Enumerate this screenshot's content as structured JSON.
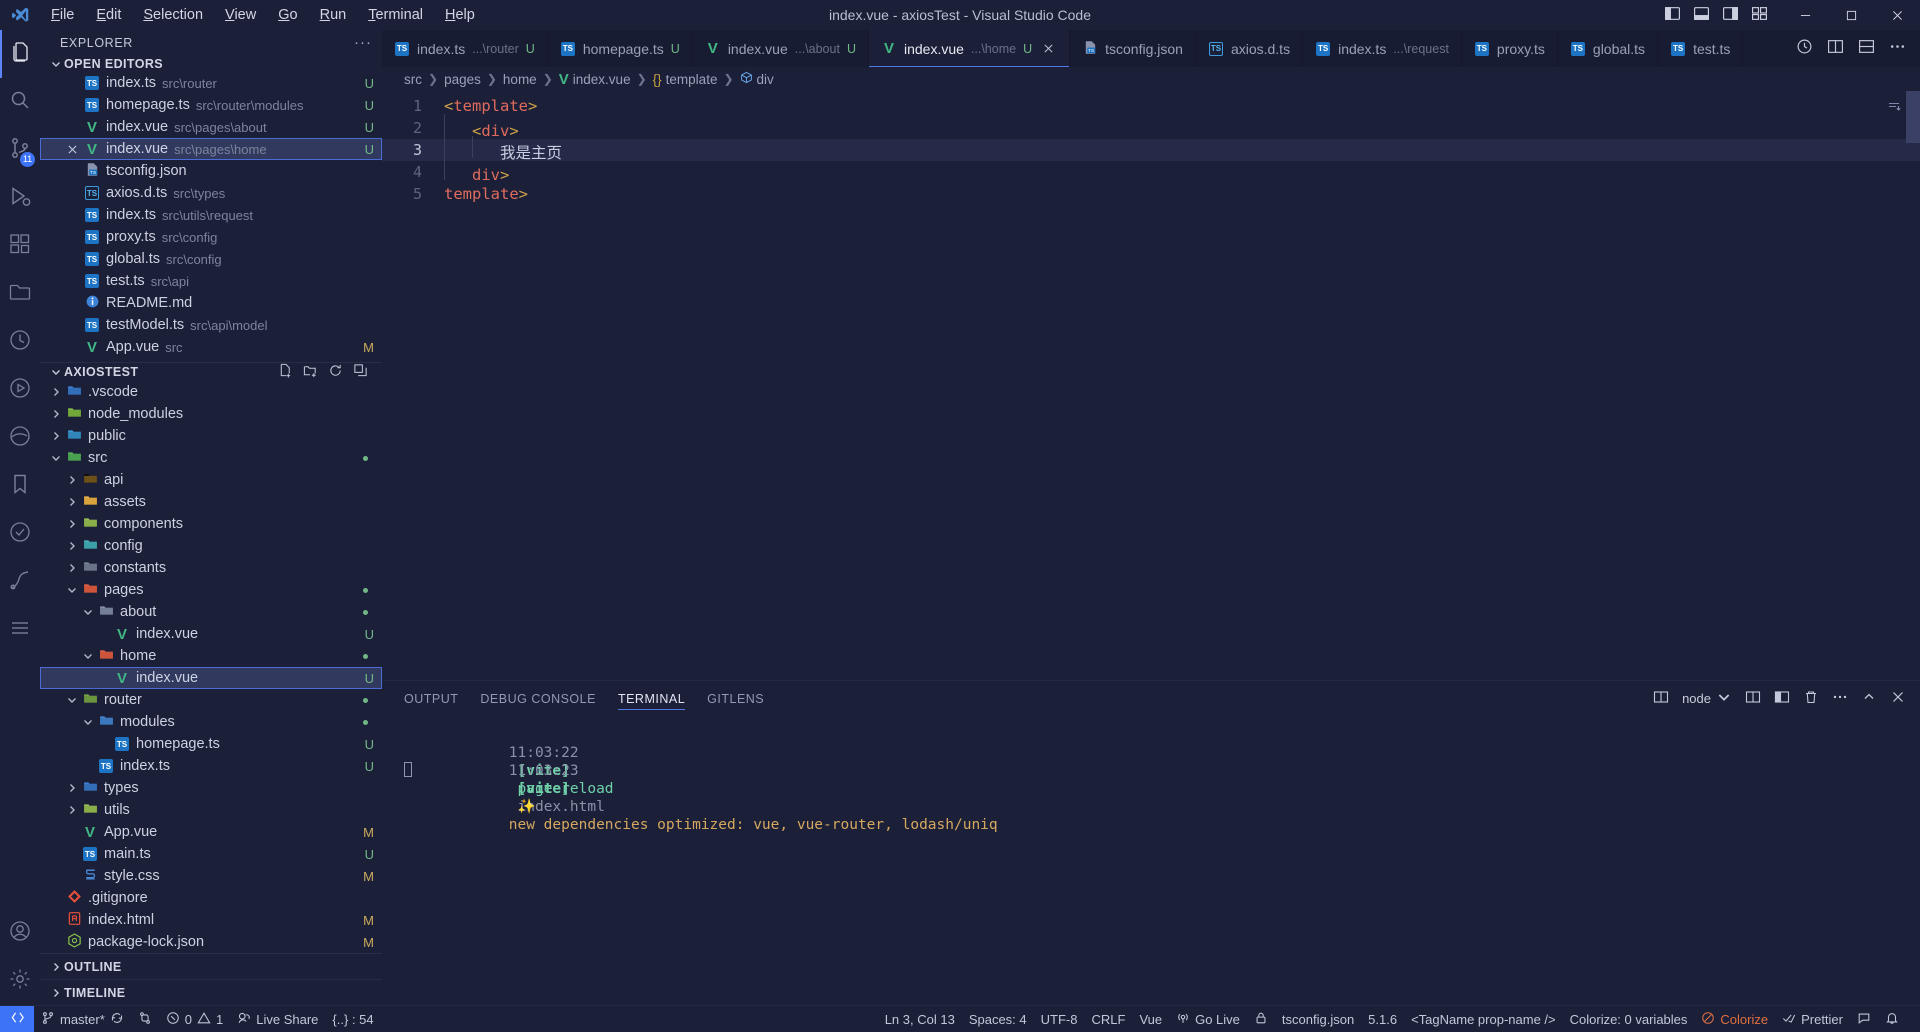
{
  "window": {
    "title": "index.vue - axiosTest - Visual Studio Code",
    "menu": [
      "File",
      "Edit",
      "Selection",
      "View",
      "Go",
      "Run",
      "Terminal",
      "Help"
    ],
    "layout_icons": [
      "toggle-primary-sidebar-icon",
      "toggle-panel-icon",
      "toggle-secondary-sidebar-icon",
      "customize-layout-icon"
    ],
    "controls": [
      "minimize",
      "maximize",
      "close"
    ]
  },
  "activitybar": {
    "items": [
      {
        "name": "explorer",
        "icon": "files-icon",
        "active": true,
        "badge": ""
      },
      {
        "name": "search",
        "icon": "search-icon",
        "active": false,
        "badge": ""
      },
      {
        "name": "source-control",
        "icon": "source-control-icon",
        "active": false,
        "badge": "11"
      },
      {
        "name": "run-and-debug",
        "icon": "debug-icon",
        "active": false,
        "badge": ""
      },
      {
        "name": "extensions",
        "icon": "extensions-icon",
        "active": false,
        "badge": ""
      },
      {
        "name": "explorer-alt",
        "icon": "folder-icon",
        "active": false,
        "badge": ""
      },
      {
        "name": "testing",
        "icon": "beaker-icon",
        "active": false,
        "badge": ""
      },
      {
        "name": "live-preview",
        "icon": "play-circle-icon",
        "active": false,
        "badge": ""
      },
      {
        "name": "browser-preview",
        "icon": "edge-icon",
        "active": false,
        "badge": ""
      },
      {
        "name": "bookmarks",
        "icon": "bookmark-icon",
        "active": false,
        "badge": ""
      },
      {
        "name": "todo-tree",
        "icon": "checklist-circle-icon",
        "active": false,
        "badge": ""
      },
      {
        "name": "git-graph",
        "icon": "git-graph-icon",
        "active": false,
        "badge": ""
      },
      {
        "name": "outline-list",
        "icon": "list-icon",
        "active": false,
        "badge": ""
      }
    ],
    "bottom": [
      {
        "name": "accounts",
        "icon": "account-icon"
      },
      {
        "name": "manage",
        "icon": "gear-icon"
      }
    ]
  },
  "sidebar": {
    "header": "EXPLORER",
    "header_more": "···",
    "open_editors": {
      "label": "OPEN EDITORS",
      "items": [
        {
          "icon": "ts-file-icon",
          "name": "index.ts",
          "desc": "src\\router",
          "badge": "U",
          "badge_color": "green",
          "selected": false,
          "show_close": false
        },
        {
          "icon": "ts-file-icon",
          "name": "homepage.ts",
          "desc": "src\\router\\modules",
          "badge": "U",
          "badge_color": "green",
          "selected": false,
          "show_close": false
        },
        {
          "icon": "vue-file-icon",
          "name": "index.vue",
          "desc": "src\\pages\\about",
          "badge": "U",
          "badge_color": "green",
          "selected": false,
          "show_close": false
        },
        {
          "icon": "vue-file-icon",
          "name": "index.vue",
          "desc": "src\\pages\\home",
          "badge": "U",
          "badge_color": "green",
          "selected": true,
          "show_close": true
        },
        {
          "icon": "tsconfig-file-icon",
          "name": "tsconfig.json",
          "desc": "",
          "badge": "",
          "badge_color": "",
          "selected": false,
          "show_close": false
        },
        {
          "icon": "dts-file-icon",
          "name": "axios.d.ts",
          "desc": "src\\types",
          "badge": "",
          "badge_color": "",
          "selected": false,
          "show_close": false
        },
        {
          "icon": "ts-file-icon",
          "name": "index.ts",
          "desc": "src\\utils\\request",
          "badge": "",
          "badge_color": "",
          "selected": false,
          "show_close": false
        },
        {
          "icon": "ts-file-icon",
          "name": "proxy.ts",
          "desc": "src\\config",
          "badge": "",
          "badge_color": "",
          "selected": false,
          "show_close": false
        },
        {
          "icon": "ts-file-icon",
          "name": "global.ts",
          "desc": "src\\config",
          "badge": "",
          "badge_color": "",
          "selected": false,
          "show_close": false
        },
        {
          "icon": "ts-file-icon",
          "name": "test.ts",
          "desc": "src\\api",
          "badge": "",
          "badge_color": "",
          "selected": false,
          "show_close": false
        },
        {
          "icon": "readme-file-icon",
          "name": "README.md",
          "desc": "",
          "badge": "",
          "badge_color": "",
          "selected": false,
          "show_close": false
        },
        {
          "icon": "ts-file-icon",
          "name": "testModel.ts",
          "desc": "src\\api\\model",
          "badge": "",
          "badge_color": "",
          "selected": false,
          "show_close": false
        },
        {
          "icon": "vue-file-icon",
          "name": "App.vue",
          "desc": "src",
          "badge": "M",
          "badge_color": "yellow",
          "selected": false,
          "show_close": false
        }
      ]
    },
    "project": {
      "label": "AXIOSTEST",
      "actions": [
        "new-file-icon",
        "new-folder-icon",
        "refresh-icon",
        "collapse-all-icon"
      ],
      "tree": [
        {
          "depth": 1,
          "twisty": "right",
          "icon": "folder-vscode-icon",
          "name": ".vscode",
          "badge": "",
          "badge_color": "",
          "dimmed": false,
          "selected": false,
          "dot": false
        },
        {
          "depth": 1,
          "twisty": "right",
          "icon": "folder-node-icon",
          "name": "node_modules",
          "badge": "",
          "badge_color": "",
          "dimmed": true,
          "selected": false,
          "dot": false
        },
        {
          "depth": 1,
          "twisty": "right",
          "icon": "folder-public-icon",
          "name": "public",
          "badge": "",
          "badge_color": "",
          "dimmed": false,
          "selected": false,
          "dot": false
        },
        {
          "depth": 1,
          "twisty": "down",
          "icon": "folder-src-icon",
          "name": "src",
          "badge": "",
          "badge_color": "",
          "dimmed": false,
          "selected": false,
          "dot": true
        },
        {
          "depth": 2,
          "twisty": "right",
          "icon": "folder-api-icon",
          "name": "api",
          "badge": "",
          "badge_color": "",
          "dimmed": false,
          "selected": false,
          "dot": false
        },
        {
          "depth": 2,
          "twisty": "right",
          "icon": "folder-assets-icon",
          "name": "assets",
          "badge": "",
          "badge_color": "",
          "dimmed": false,
          "selected": false,
          "dot": false
        },
        {
          "depth": 2,
          "twisty": "right",
          "icon": "folder-components-icon",
          "name": "components",
          "badge": "",
          "badge_color": "",
          "dimmed": false,
          "selected": false,
          "dot": false
        },
        {
          "depth": 2,
          "twisty": "right",
          "icon": "folder-config-icon",
          "name": "config",
          "badge": "",
          "badge_color": "",
          "dimmed": false,
          "selected": false,
          "dot": false
        },
        {
          "depth": 2,
          "twisty": "right",
          "icon": "folder-constants-icon",
          "name": "constants",
          "badge": "",
          "badge_color": "",
          "dimmed": false,
          "selected": false,
          "dot": false
        },
        {
          "depth": 2,
          "twisty": "down",
          "icon": "folder-pages-icon",
          "name": "pages",
          "badge": "",
          "badge_color": "",
          "dimmed": false,
          "selected": false,
          "dot": true
        },
        {
          "depth": 3,
          "twisty": "down",
          "icon": "folder-open-icon",
          "name": "about",
          "badge": "",
          "badge_color": "",
          "dimmed": false,
          "selected": false,
          "dot": true
        },
        {
          "depth": 4,
          "twisty": "none",
          "icon": "vue-file-icon",
          "name": "index.vue",
          "badge": "U",
          "badge_color": "green",
          "dimmed": false,
          "selected": false,
          "dot": false
        },
        {
          "depth": 3,
          "twisty": "down",
          "icon": "folder-home-icon",
          "name": "home",
          "badge": "",
          "badge_color": "",
          "dimmed": false,
          "selected": false,
          "dot": true
        },
        {
          "depth": 4,
          "twisty": "none",
          "icon": "vue-file-icon",
          "name": "index.vue",
          "badge": "U",
          "badge_color": "green",
          "dimmed": false,
          "selected": true,
          "dot": false
        },
        {
          "depth": 2,
          "twisty": "down",
          "icon": "folder-router-icon",
          "name": "router",
          "badge": "",
          "badge_color": "",
          "dimmed": false,
          "selected": false,
          "dot": true
        },
        {
          "depth": 3,
          "twisty": "down",
          "icon": "folder-modules-icon",
          "name": "modules",
          "badge": "",
          "badge_color": "",
          "dimmed": false,
          "selected": false,
          "dot": true
        },
        {
          "depth": 4,
          "twisty": "none",
          "icon": "ts-file-icon",
          "name": "homepage.ts",
          "badge": "U",
          "badge_color": "green",
          "dimmed": false,
          "selected": false,
          "dot": false
        },
        {
          "depth": 3,
          "twisty": "none",
          "icon": "ts-file-icon",
          "name": "index.ts",
          "badge": "U",
          "badge_color": "green",
          "dimmed": false,
          "selected": false,
          "dot": false
        },
        {
          "depth": 2,
          "twisty": "right",
          "icon": "folder-types-icon",
          "name": "types",
          "badge": "",
          "badge_color": "",
          "dimmed": false,
          "selected": false,
          "dot": false
        },
        {
          "depth": 2,
          "twisty": "right",
          "icon": "folder-utils-icon",
          "name": "utils",
          "badge": "",
          "badge_color": "",
          "dimmed": false,
          "selected": false,
          "dot": false
        },
        {
          "depth": 2,
          "twisty": "none",
          "icon": "vue-file-icon",
          "name": "App.vue",
          "badge": "M",
          "badge_color": "yellow",
          "dimmed": false,
          "selected": false,
          "dot": false
        },
        {
          "depth": 2,
          "twisty": "none",
          "icon": "ts-file-icon",
          "name": "main.ts",
          "badge": "U",
          "badge_color": "green",
          "dimmed": false,
          "selected": false,
          "dot": false
        },
        {
          "depth": 2,
          "twisty": "none",
          "icon": "css-file-icon",
          "name": "style.css",
          "badge": "M",
          "badge_color": "yellow",
          "dimmed": false,
          "selected": false,
          "dot": false
        },
        {
          "depth": 1,
          "twisty": "none",
          "icon": "git-file-icon",
          "name": ".gitignore",
          "badge": "",
          "badge_color": "",
          "dimmed": false,
          "selected": false,
          "dot": false
        },
        {
          "depth": 1,
          "twisty": "none",
          "icon": "html-file-icon",
          "name": "index.html",
          "badge": "M",
          "badge_color": "yellow",
          "dimmed": false,
          "selected": false,
          "dot": false
        },
        {
          "depth": 1,
          "twisty": "none",
          "icon": "npm-lock-file-icon",
          "name": "package-lock.json",
          "badge": "M",
          "badge_color": "yellow",
          "dimmed": false,
          "selected": false,
          "dot": false
        }
      ]
    },
    "outline": "OUTLINE",
    "timeline": "TIMELINE"
  },
  "editor": {
    "tabs": [
      {
        "icon": "ts-file-icon",
        "name": "index.ts",
        "desc": "...\\router",
        "mod": "U",
        "active": false,
        "close": false
      },
      {
        "icon": "ts-file-icon",
        "name": "homepage.ts",
        "desc": "",
        "mod": "U",
        "active": false,
        "close": false
      },
      {
        "icon": "vue-file-icon",
        "name": "index.vue",
        "desc": "...\\about",
        "mod": "U",
        "active": false,
        "close": false
      },
      {
        "icon": "vue-file-icon",
        "name": "index.vue",
        "desc": "...\\home",
        "mod": "U",
        "active": true,
        "close": true
      },
      {
        "icon": "tsconfig-file-icon",
        "name": "tsconfig.json",
        "desc": "",
        "mod": "",
        "active": false,
        "close": false
      },
      {
        "icon": "dts-file-icon",
        "name": "axios.d.ts",
        "desc": "",
        "mod": "",
        "active": false,
        "close": false
      },
      {
        "icon": "ts-file-icon",
        "name": "index.ts",
        "desc": "...\\request",
        "mod": "",
        "active": false,
        "close": false
      },
      {
        "icon": "ts-file-icon",
        "name": "proxy.ts",
        "desc": "",
        "mod": "",
        "active": false,
        "close": false
      },
      {
        "icon": "ts-file-icon",
        "name": "global.ts",
        "desc": "",
        "mod": "",
        "active": false,
        "close": false
      },
      {
        "icon": "ts-file-icon",
        "name": "test.ts",
        "desc": "",
        "mod": "",
        "active": false,
        "close": false
      }
    ],
    "tab_actions": [
      "timeline-icon",
      "split-editor-icon",
      "split-editor-down-icon",
      "more-actions-icon"
    ],
    "breadcrumbs": [
      {
        "label": "src",
        "icon": ""
      },
      {
        "label": "pages",
        "icon": ""
      },
      {
        "label": "home",
        "icon": ""
      },
      {
        "label": "index.vue",
        "icon": "vue-file-icon"
      },
      {
        "label": "template",
        "icon": "braces-icon"
      },
      {
        "label": "div",
        "icon": "symbol-object-icon"
      }
    ],
    "lines": [
      {
        "num": "1",
        "indent": 0,
        "guides": 0,
        "tokens": [
          {
            "t": "punc",
            "v": "<"
          },
          {
            "t": "tag",
            "v": "template"
          },
          {
            "t": "punc",
            "v": ">"
          }
        ],
        "current": false
      },
      {
        "num": "2",
        "indent": 1,
        "guides": 1,
        "tokens": [
          {
            "t": "punc",
            "v": "<"
          },
          {
            "t": "tag",
            "v": "div"
          },
          {
            "t": "punc",
            "v": ">"
          }
        ],
        "current": false
      },
      {
        "num": "3",
        "indent": 2,
        "guides": 2,
        "tokens": [
          {
            "t": "text",
            "v": "我是主页"
          }
        ],
        "current": true
      },
      {
        "num": "4",
        "indent": 1,
        "guides": 1,
        "tokens": [
          {
            "t": "punc",
            "v": "</"
          },
          {
            "t": "tag",
            "v": "div"
          },
          {
            "t": "punc",
            "v": ">"
          }
        ],
        "current": false
      },
      {
        "num": "5",
        "indent": 0,
        "guides": 0,
        "tokens": [
          {
            "t": "punc",
            "v": "</"
          },
          {
            "t": "tag",
            "v": "template"
          },
          {
            "t": "punc",
            "v": ">"
          }
        ],
        "current": false
      }
    ]
  },
  "panel": {
    "tabs": [
      "OUTPUT",
      "DEBUG CONSOLE",
      "TERMINAL",
      "GITLENS"
    ],
    "active_tab": "TERMINAL",
    "terminal_selector": "node",
    "actions": [
      "split-terminal-icon",
      "terminal-dropdown-icon",
      "new-terminal-icon",
      "split-icon",
      "kill-terminal-icon",
      "more-icon",
      "maximize-panel-icon",
      "close-panel-icon"
    ],
    "lines": [
      {
        "time": "11:03:22",
        "tag": "[vite]",
        "msg": "page reload",
        "arg": "index.html",
        "sparkle": false
      },
      {
        "time": "11:03:23",
        "tag": "[vite]",
        "msg": "new dependencies optimized: vue, vue-router, lodash/uniq",
        "arg": "",
        "sparkle": true
      }
    ]
  },
  "statusbar": {
    "remote_icon": "remote-window-icon",
    "left": [
      {
        "icon": "git-branch-icon",
        "label": "master*",
        "extra_icon": "sync-icon"
      },
      {
        "icon": "git-compare-icon",
        "label": ""
      },
      {
        "icon": "error-icon",
        "label": "0",
        "icon2": "warning-icon",
        "label2": "1"
      },
      {
        "icon": "live-share-icon",
        "label": "Live Share"
      },
      {
        "icon": "",
        "label": "{..} : 54"
      }
    ],
    "right": [
      {
        "label": "Ln 3, Col 13"
      },
      {
        "label": "Spaces: 4"
      },
      {
        "label": "UTF-8"
      },
      {
        "label": "CRLF"
      },
      {
        "label": "Vue"
      },
      {
        "icon": "broadcast-icon",
        "label": "Go Live"
      },
      {
        "icon": "lock-icon",
        "label": ""
      },
      {
        "label": "tsconfig.json"
      },
      {
        "label": "5.1.6"
      },
      {
        "label": "<TagName prop-name />"
      },
      {
        "label": "Colorize: 0 variables"
      },
      {
        "icon": "colorize-icon",
        "label": "Colorize",
        "color": "#e0703f"
      },
      {
        "icon": "check-icon",
        "label": "Prettier"
      },
      {
        "icon": "feedback-icon",
        "label": ""
      },
      {
        "icon": "bell-icon",
        "label": ""
      }
    ]
  }
}
